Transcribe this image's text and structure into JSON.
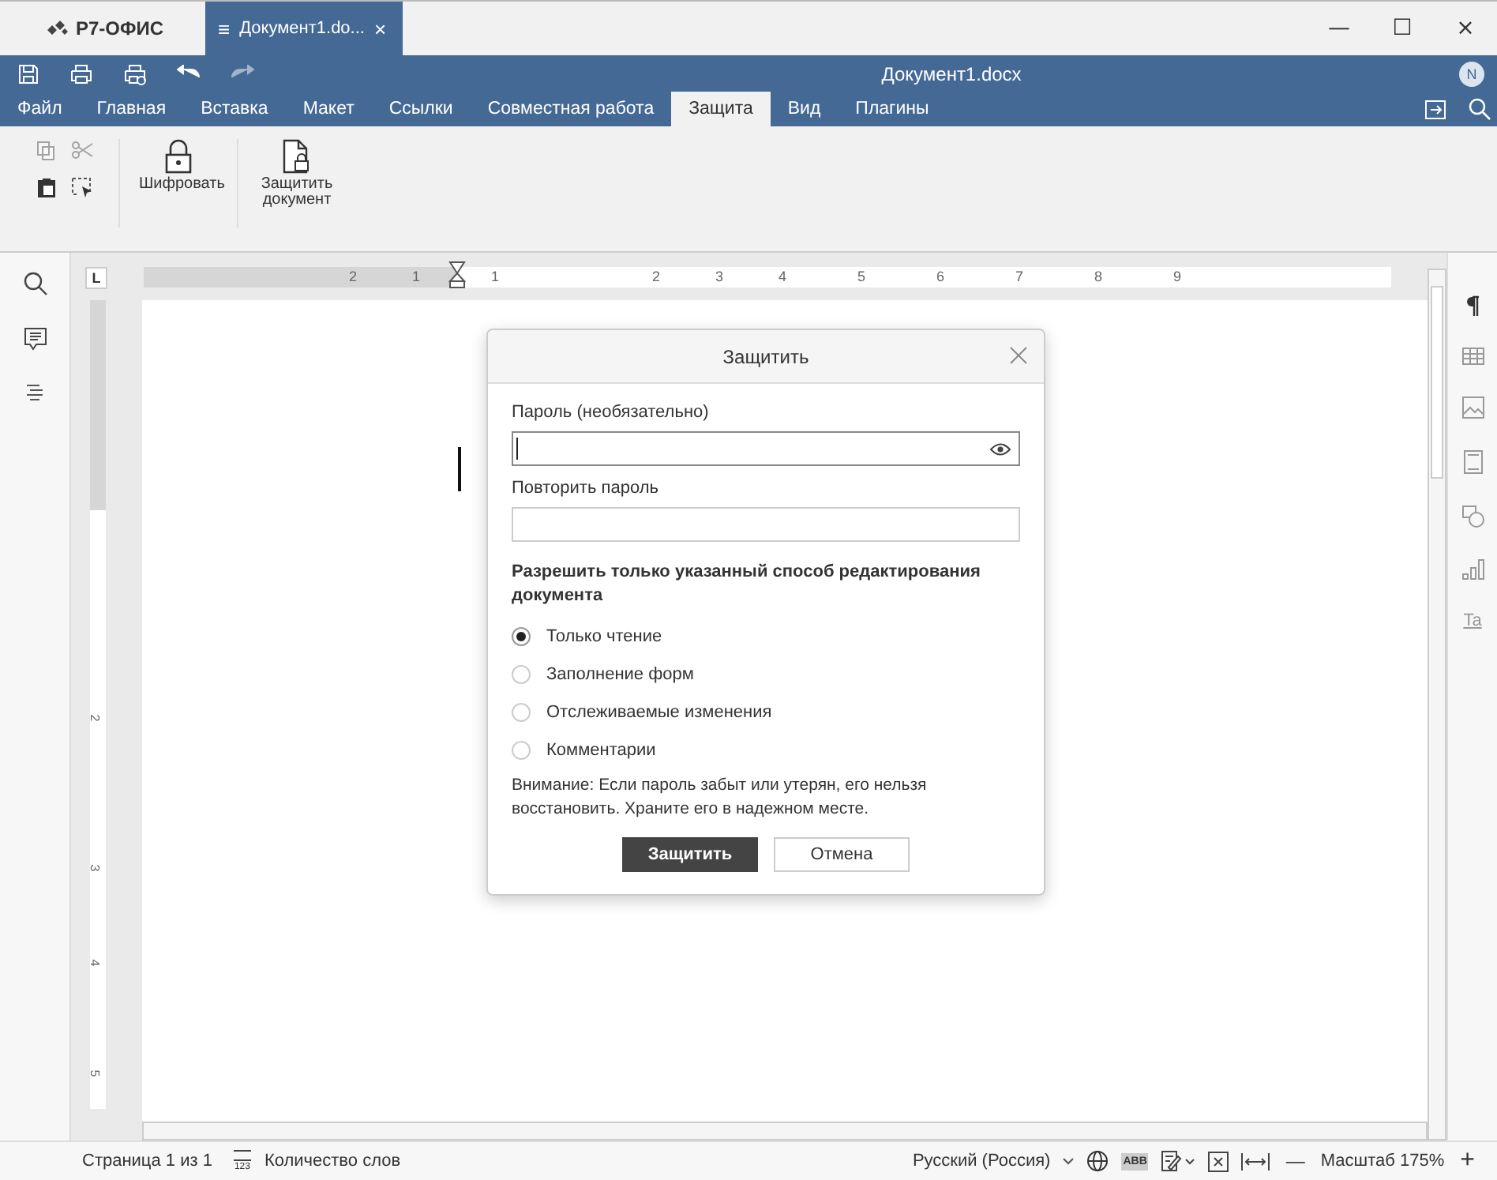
{
  "app": {
    "name": "Р7-ОФИС"
  },
  "doc_tab": {
    "label": "Документ1.do...",
    "menu_glyph": "≡",
    "close_glyph": "×"
  },
  "window_controls": [
    "—",
    "☐",
    "×"
  ],
  "header": {
    "title": "Документ1.docx",
    "user_initial": "N"
  },
  "ribbon_tabs": [
    {
      "label": "Файл",
      "selected": false
    },
    {
      "label": "Главная",
      "selected": false
    },
    {
      "label": "Вставка",
      "selected": false
    },
    {
      "label": "Макет",
      "selected": false
    },
    {
      "label": "Ссылки",
      "selected": false
    },
    {
      "label": "Совместная работа",
      "selected": false
    },
    {
      "label": "Защита",
      "selected": true
    },
    {
      "label": "Вид",
      "selected": false
    },
    {
      "label": "Плагины",
      "selected": false
    }
  ],
  "toolbar": {
    "buttons": [
      {
        "label": "Шифровать",
        "kind": "lock"
      },
      {
        "label": "Защитить документ",
        "kind": "doc-lock"
      }
    ]
  },
  "ruler": {
    "corner": "L",
    "h_labels": [
      "2",
      "1",
      "1",
      "2",
      "3",
      "4",
      "5",
      "6",
      "7",
      "8",
      "9"
    ],
    "v_labels": [
      "2",
      "3",
      "4",
      "5"
    ]
  },
  "right_rail": {
    "text_art": "Ta"
  },
  "dialog": {
    "title": "Защитить",
    "password": {
      "label": "Пароль (необязательно)"
    },
    "repeat": {
      "label": "Повторить пароль"
    },
    "mode_heading": "Разрешить только указанный способ редактирования документа",
    "options": [
      {
        "label": "Только чтение",
        "selected": true
      },
      {
        "label": "Заполнение форм",
        "selected": false
      },
      {
        "label": "Отслеживаемые изменения",
        "selected": false
      },
      {
        "label": "Комментарии",
        "selected": false
      }
    ],
    "warning": "Внимание: Если пароль забыт или утерян, его нельзя восстановить. Храните его в надежном месте.",
    "buttons": [
      {
        "label": "Защитить",
        "kind": "primary"
      },
      {
        "label": "Отмена",
        "kind": "secondary"
      }
    ]
  },
  "status_bar": {
    "page": "Страница 1 из 1",
    "word_count": "Количество слов",
    "word_count_icon": "123",
    "language": "Русский (Россия)",
    "spell_icon": "ABB",
    "zoom": "Масштаб 175%",
    "zoom_out": "—",
    "zoom_in": "+"
  }
}
